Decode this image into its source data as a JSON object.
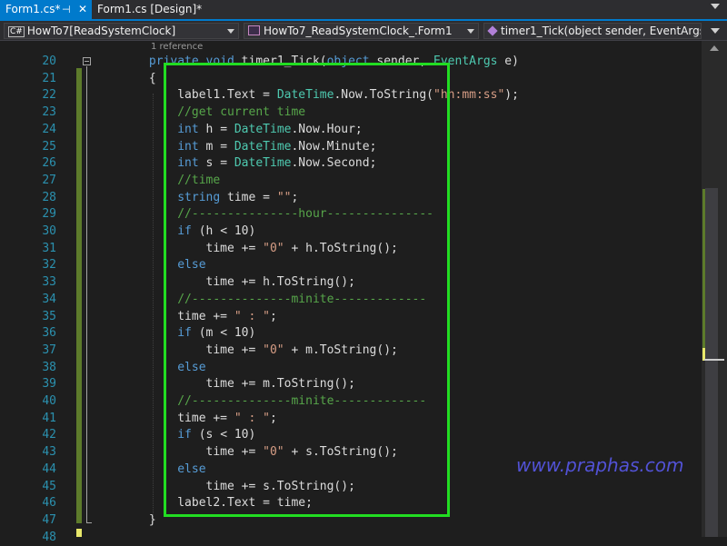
{
  "tabs": {
    "active": {
      "label": "Form1.cs*",
      "pin": "⊣",
      "close": "✕"
    },
    "inactive": {
      "label": "Form1.cs [Design]*"
    }
  },
  "navbar": {
    "project": "HowTo7[ReadSystemClock]",
    "class": "HowTo7_ReadSystemClock_.Form1",
    "member": "timer1_Tick(object sender, EventArgs e)",
    "project_icon": "C#"
  },
  "editor": {
    "reference_hint": "1 reference",
    "lines": [
      {
        "num": "20",
        "tokens": [
          [
            "            ",
            ""
          ],
          [
            "private",
            "kw"
          ],
          [
            " ",
            ""
          ],
          [
            "void",
            "kw"
          ],
          [
            " timer1_Tick(",
            ""
          ],
          [
            "object",
            "kw"
          ],
          [
            " sender, ",
            ""
          ],
          [
            "EventArgs",
            "ty"
          ],
          [
            " e)",
            ""
          ]
        ]
      },
      {
        "num": "21",
        "tokens": [
          [
            "            {",
            ""
          ]
        ]
      },
      {
        "num": "22",
        "tokens": [
          [
            "                label1.Text = ",
            ""
          ],
          [
            "DateTime",
            "ty"
          ],
          [
            ".Now.ToString(",
            ""
          ],
          [
            "\"hh:mm:ss\"",
            "st"
          ],
          [
            ");",
            ""
          ]
        ]
      },
      {
        "num": "23",
        "tokens": [
          [
            "                ",
            ""
          ],
          [
            "//get current time",
            "cm"
          ]
        ]
      },
      {
        "num": "24",
        "tokens": [
          [
            "                ",
            ""
          ],
          [
            "int",
            "kw"
          ],
          [
            " h = ",
            ""
          ],
          [
            "DateTime",
            "ty"
          ],
          [
            ".Now.Hour;",
            ""
          ]
        ]
      },
      {
        "num": "25",
        "tokens": [
          [
            "                ",
            ""
          ],
          [
            "int",
            "kw"
          ],
          [
            " m = ",
            ""
          ],
          [
            "DateTime",
            "ty"
          ],
          [
            ".Now.Minute;",
            ""
          ]
        ]
      },
      {
        "num": "26",
        "tokens": [
          [
            "                ",
            ""
          ],
          [
            "int",
            "kw"
          ],
          [
            " s = ",
            ""
          ],
          [
            "DateTime",
            "ty"
          ],
          [
            ".Now.Second;",
            ""
          ]
        ]
      },
      {
        "num": "27",
        "tokens": [
          [
            "                ",
            ""
          ],
          [
            "//time",
            "cm"
          ]
        ]
      },
      {
        "num": "28",
        "tokens": [
          [
            "                ",
            ""
          ],
          [
            "string",
            "kw"
          ],
          [
            " time = ",
            ""
          ],
          [
            "\"\"",
            "st"
          ],
          [
            ";",
            ""
          ]
        ]
      },
      {
        "num": "29",
        "tokens": [
          [
            "                ",
            ""
          ],
          [
            "//---------------hour---------------",
            "cm"
          ]
        ]
      },
      {
        "num": "30",
        "tokens": [
          [
            "                ",
            ""
          ],
          [
            "if",
            "kw"
          ],
          [
            " (h < 10)",
            ""
          ]
        ]
      },
      {
        "num": "31",
        "tokens": [
          [
            "                    time += ",
            ""
          ],
          [
            "\"0\"",
            "st"
          ],
          [
            " + h.ToString();",
            ""
          ]
        ]
      },
      {
        "num": "32",
        "tokens": [
          [
            "                ",
            ""
          ],
          [
            "else",
            "kw"
          ]
        ]
      },
      {
        "num": "33",
        "tokens": [
          [
            "                    time += h.ToString();",
            ""
          ]
        ]
      },
      {
        "num": "34",
        "tokens": [
          [
            "                ",
            ""
          ],
          [
            "//--------------minite-------------",
            "cm"
          ]
        ]
      },
      {
        "num": "35",
        "tokens": [
          [
            "                time += ",
            ""
          ],
          [
            "\" : \"",
            "st"
          ],
          [
            ";",
            ""
          ]
        ]
      },
      {
        "num": "36",
        "tokens": [
          [
            "                ",
            ""
          ],
          [
            "if",
            "kw"
          ],
          [
            " (m < 10)",
            ""
          ]
        ]
      },
      {
        "num": "37",
        "tokens": [
          [
            "                    time += ",
            ""
          ],
          [
            "\"0\"",
            "st"
          ],
          [
            " + m.ToString();",
            ""
          ]
        ]
      },
      {
        "num": "38",
        "tokens": [
          [
            "                ",
            ""
          ],
          [
            "else",
            "kw"
          ]
        ]
      },
      {
        "num": "39",
        "tokens": [
          [
            "                    time += m.ToString();",
            ""
          ]
        ]
      },
      {
        "num": "40",
        "tokens": [
          [
            "                ",
            ""
          ],
          [
            "//--------------minite-------------",
            "cm"
          ]
        ]
      },
      {
        "num": "41",
        "tokens": [
          [
            "                time += ",
            ""
          ],
          [
            "\" : \"",
            "st"
          ],
          [
            ";",
            ""
          ]
        ]
      },
      {
        "num": "42",
        "tokens": [
          [
            "                ",
            ""
          ],
          [
            "if",
            "kw"
          ],
          [
            " (s < 10)",
            ""
          ]
        ]
      },
      {
        "num": "43",
        "tokens": [
          [
            "                    time += ",
            ""
          ],
          [
            "\"0\"",
            "st"
          ],
          [
            " + s.ToString();",
            ""
          ]
        ]
      },
      {
        "num": "44",
        "tokens": [
          [
            "                ",
            ""
          ],
          [
            "else",
            "kw"
          ]
        ]
      },
      {
        "num": "45",
        "tokens": [
          [
            "                    time += s.ToString();",
            ""
          ]
        ]
      },
      {
        "num": "46",
        "tokens": [
          [
            "                label2.Text = time;",
            ""
          ]
        ]
      },
      {
        "num": "47",
        "tokens": [
          [
            "            }",
            ""
          ]
        ]
      },
      {
        "num": "48",
        "tokens": [
          [
            "",
            ""
          ]
        ]
      }
    ]
  },
  "watermark": "www.praphas.com",
  "colors": {
    "accent": "#007acc",
    "highlight_box": "#22dd22",
    "keyword": "#569cd6",
    "type": "#4ec9b0",
    "string": "#d69d85",
    "comment": "#57a64a",
    "line_number": "#2b91af"
  }
}
